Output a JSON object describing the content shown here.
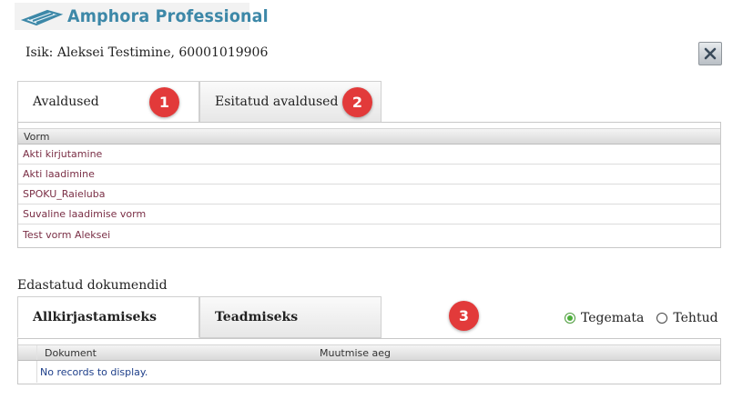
{
  "app": {
    "logo_text": "Amphora Professional",
    "brand_color": "#3d88a8"
  },
  "person": {
    "label": "Isik: Aleksei Testimine, 60001019906"
  },
  "close": {
    "icon": "close-icon"
  },
  "tabs_top": [
    {
      "label": "Avaldused",
      "active": true
    },
    {
      "label": "Esitatud avaldused",
      "active": false
    }
  ],
  "badges": [
    "1",
    "2",
    "3"
  ],
  "forms_grid": {
    "header": "Vorm",
    "rows": [
      "Akti kirjutamine",
      "Akti laadimine",
      "SPOKU_Raieluba",
      "Suvaline laadimise vorm",
      "Test vorm Aleksei"
    ]
  },
  "documents": {
    "title": "Edastatud dokumendid",
    "tabs": [
      {
        "label": "Allkirjastamiseks",
        "active": true
      },
      {
        "label": "Teadmiseks",
        "active": false
      }
    ],
    "filters": [
      {
        "label": "Tegemata",
        "checked": true
      },
      {
        "label": "Tehtud",
        "checked": false
      }
    ],
    "grid": {
      "columns": [
        "Dokument",
        "Muutmise aeg"
      ],
      "empty_text": "No records to display."
    }
  },
  "colors": {
    "badge": "#e23a3a",
    "link": "#7a2e45",
    "radio_checked": "#4caf3a"
  }
}
